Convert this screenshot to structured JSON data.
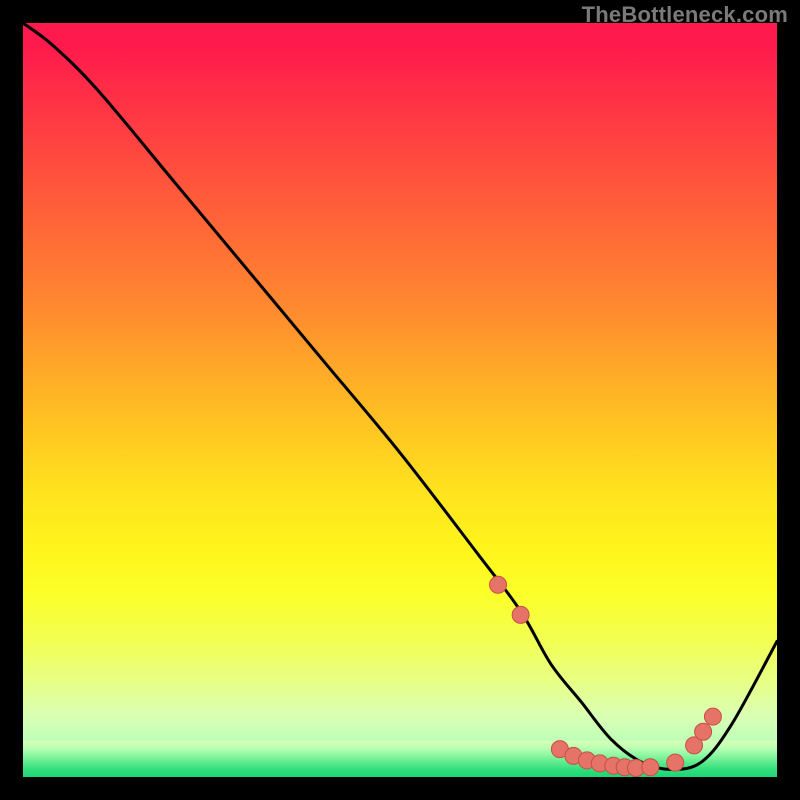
{
  "watermark": {
    "text": "TheBottleneck.com"
  },
  "colors": {
    "curve_stroke": "#000000",
    "dot_fill": "#e57368",
    "dot_stroke": "#c84f46"
  },
  "chart_data": {
    "type": "line",
    "title": "",
    "xlabel": "",
    "ylabel": "",
    "xlim": [
      0,
      100
    ],
    "ylim": [
      0,
      100
    ],
    "grid": false,
    "series": [
      {
        "name": "bottleneck-curve",
        "x": [
          0,
          4,
          10,
          20,
          30,
          40,
          50,
          60,
          66,
          70,
          74,
          78,
          82,
          86,
          90,
          94,
          100
        ],
        "values": [
          100,
          97,
          91,
          79,
          67,
          55,
          43,
          30,
          22,
          15,
          10,
          5,
          2,
          1,
          2,
          7,
          18
        ]
      }
    ],
    "dots": {
      "name": "highlight-dots",
      "x": [
        63.0,
        66.0,
        71.2,
        73.0,
        74.8,
        76.5,
        78.3,
        79.8,
        81.3,
        83.2,
        86.5,
        89.0,
        90.2,
        91.5
      ],
      "values": [
        25.5,
        21.5,
        3.7,
        2.8,
        2.2,
        1.8,
        1.5,
        1.3,
        1.2,
        1.3,
        1.9,
        4.2,
        6.0,
        8.0
      ]
    }
  }
}
